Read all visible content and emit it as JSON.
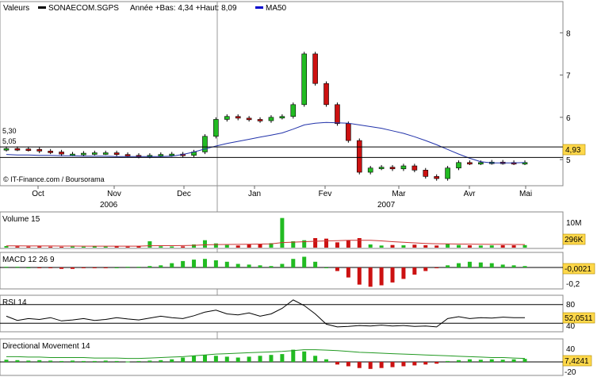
{
  "header": {
    "values_label": "Valeurs",
    "symbol": "SONAECOM.SGPS",
    "range_text": "Année +Bas: 4,34 +Haut: 8,09",
    "ma_label": "MA50",
    "symbol_color": "#000000",
    "ma_color": "#0000cc"
  },
  "watermark": "© IT-Finance.com / Boursorama",
  "colors": {
    "up": "#22bb22",
    "down": "#cc1111",
    "ma": "#2233aa",
    "grid": "#bbbbbb"
  },
  "x_axis": {
    "months": [
      "Oct",
      "Nov",
      "Dec",
      "Jan",
      "Fev",
      "Mar",
      "Avr",
      "Mai"
    ],
    "years": [
      "2006",
      "2007"
    ]
  },
  "chart_data": [
    {
      "type": "candlestick",
      "title": "SONAECOM.SGPS",
      "yticks": [
        5,
        6,
        7,
        8
      ],
      "ylim": [
        4.55,
        8.4
      ],
      "left_marks": [
        "5,30",
        "5,05"
      ],
      "hlines": [
        5.3,
        5.05
      ],
      "last_value": "4,93",
      "series": [
        {
          "name": "SONAECOM.SGPS",
          "style": "ohlc",
          "weekly_close": [
            5.26,
            5.25,
            5.24,
            5.2,
            5.18,
            5.13,
            5.13,
            5.15,
            5.16,
            5.16,
            5.12,
            5.1,
            5.08,
            5.1,
            5.12,
            5.13,
            5.1,
            5.18,
            5.55,
            5.95,
            6.02,
            5.98,
            5.95,
            5.92,
            6.0,
            6.02,
            6.3,
            7.5,
            6.8,
            6.3,
            5.85,
            5.45,
            4.7,
            4.8,
            4.82,
            4.78,
            4.85,
            4.75,
            4.6,
            4.55,
            4.8,
            4.93,
            4.92,
            4.93,
            4.94,
            4.93,
            4.92,
            4.93
          ]
        },
        {
          "name": "MA50",
          "style": "line",
          "values": [
            5.12,
            5.11,
            5.11,
            5.1,
            5.1,
            5.09,
            5.09,
            5.08,
            5.08,
            5.08,
            5.07,
            5.07,
            5.07,
            5.07,
            5.07,
            5.08,
            5.12,
            5.18,
            5.25,
            5.32,
            5.38,
            5.43,
            5.48,
            5.53,
            5.58,
            5.63,
            5.72,
            5.82,
            5.86,
            5.88,
            5.87,
            5.86,
            5.82,
            5.78,
            5.74,
            5.68,
            5.62,
            5.54,
            5.45,
            5.35,
            5.24,
            5.13,
            5.03,
            4.95,
            4.92,
            4.92,
            4.92,
            4.93
          ]
        }
      ]
    },
    {
      "type": "bar",
      "title": "Volume 15",
      "yticks": [
        "10M"
      ],
      "last_value": "296K",
      "series": [
        {
          "name": "Volume",
          "values_k": [
            150,
            120,
            100,
            110,
            90,
            80,
            100,
            90,
            120,
            100,
            110,
            95,
            140,
            600,
            130,
            110,
            120,
            300,
            700,
            400,
            250,
            200,
            300,
            350,
            420,
            2800,
            600,
            700,
            900,
            850,
            500,
            700,
            900,
            300,
            200,
            250,
            220,
            280,
            230,
            200,
            350,
            250,
            220,
            200,
            210,
            230,
            220,
            240
          ]
        },
        {
          "name": "Volume MA",
          "values_k": [
            170,
            165,
            160,
            158,
            155,
            150,
            148,
            145,
            144,
            142,
            141,
            140,
            145,
            180,
            185,
            190,
            195,
            215,
            260,
            290,
            300,
            310,
            320,
            340,
            360,
            480,
            520,
            560,
            600,
            640,
            660,
            690,
            700,
            690,
            640,
            560,
            500,
            450,
            400,
            370,
            350,
            340,
            330,
            320,
            310,
            305,
            300,
            296
          ]
        }
      ]
    },
    {
      "type": "histogram",
      "title": "MACD 12 26 9",
      "yticks": [
        "-0,2"
      ],
      "last_value": "-0,0021",
      "series": [
        {
          "name": "MACD hist",
          "values": [
            0.01,
            0.01,
            0.0,
            -0.01,
            -0.01,
            -0.02,
            -0.02,
            -0.01,
            -0.01,
            -0.01,
            0.0,
            0.01,
            0.01,
            0.02,
            0.03,
            0.06,
            0.09,
            0.11,
            0.12,
            0.1,
            0.08,
            0.05,
            0.04,
            0.03,
            0.02,
            0.05,
            0.12,
            0.15,
            0.08,
            0.0,
            -0.05,
            -0.14,
            -0.24,
            -0.27,
            -0.25,
            -0.21,
            -0.16,
            -0.1,
            -0.05,
            -0.01,
            0.03,
            0.06,
            0.08,
            0.07,
            0.06,
            0.04,
            0.03,
            0.02
          ]
        }
      ]
    },
    {
      "type": "line",
      "title": "RSI 14",
      "yticks": [
        "80",
        "40"
      ],
      "ylim": [
        25,
        95
      ],
      "last_value": "52,0511",
      "series": [
        {
          "name": "RSI",
          "values": [
            55,
            46,
            50,
            48,
            52,
            45,
            47,
            50,
            46,
            48,
            52,
            49,
            47,
            51,
            55,
            52,
            50,
            56,
            64,
            68,
            60,
            58,
            62,
            55,
            60,
            72,
            90,
            78,
            60,
            38,
            32,
            33,
            35,
            34,
            36,
            34,
            35,
            33,
            34,
            32,
            50,
            54,
            50,
            52,
            51,
            53,
            52,
            52
          ]
        }
      ]
    },
    {
      "type": "histogram",
      "title": "Directional Movement 14",
      "yticks": [
        "40",
        "-20"
      ],
      "last_value": "7,4241",
      "series": [
        {
          "name": "DM hist",
          "values": [
            5,
            4,
            3,
            4,
            3,
            2,
            3,
            2,
            2,
            3,
            2,
            1,
            2,
            3,
            4,
            6,
            10,
            14,
            16,
            14,
            12,
            10,
            12,
            14,
            16,
            18,
            28,
            24,
            14,
            6,
            -6,
            -10,
            -14,
            -16,
            -14,
            -12,
            -10,
            -8,
            -6,
            -4,
            2,
            4,
            6,
            5,
            6,
            5,
            6,
            7
          ]
        },
        {
          "name": "ADX",
          "values": [
            12,
            12,
            11,
            11,
            10,
            10,
            10,
            10,
            9,
            9,
            9,
            8,
            8,
            9,
            10,
            11,
            12,
            14,
            16,
            18,
            19,
            20,
            21,
            22,
            23,
            24,
            26,
            28,
            28,
            27,
            26,
            24,
            22,
            21,
            20,
            19,
            18,
            17,
            16,
            15,
            14,
            13,
            12,
            11,
            10,
            10,
            9,
            8
          ]
        }
      ]
    }
  ]
}
